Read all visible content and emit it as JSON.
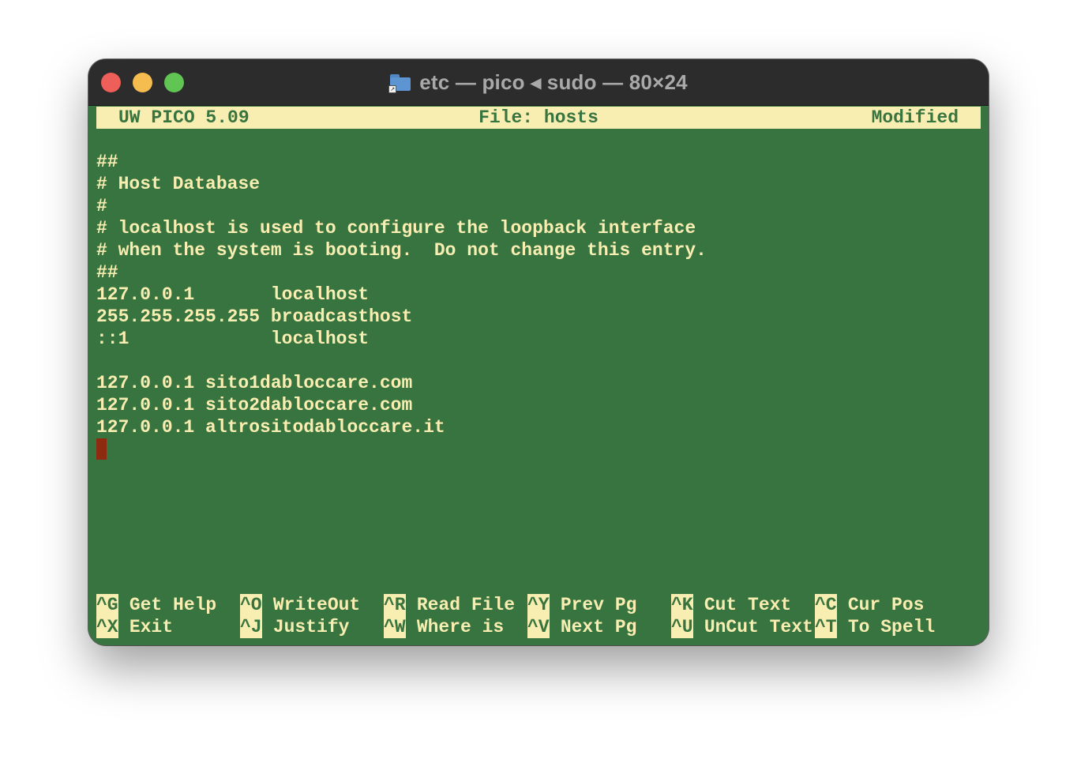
{
  "window": {
    "title": "etc — pico ◂ sudo — 80×24",
    "folder_icon": "folder-icon"
  },
  "header": {
    "app": "UW PICO 5.09",
    "file": "File: hosts",
    "status": "Modified"
  },
  "file_lines": [
    "",
    "##",
    "# Host Database",
    "#",
    "# localhost is used to configure the loopback interface",
    "# when the system is booting.  Do not change this entry.",
    "##",
    "127.0.0.1       localhost",
    "255.255.255.255 broadcasthost",
    "::1             localhost",
    "",
    "127.0.0.1 sito1dabloccare.com",
    "127.0.0.1 sito2dabloccare.com",
    "127.0.0.1 altrositodabloccare.it",
    ""
  ],
  "shortcuts": {
    "row1": [
      {
        "key": "^G",
        "label": "Get Help"
      },
      {
        "key": "^O",
        "label": "WriteOut"
      },
      {
        "key": "^R",
        "label": "Read File"
      },
      {
        "key": "^Y",
        "label": "Prev Pg"
      },
      {
        "key": "^K",
        "label": "Cut Text"
      },
      {
        "key": "^C",
        "label": "Cur Pos"
      }
    ],
    "row2": [
      {
        "key": "^X",
        "label": "Exit"
      },
      {
        "key": "^J",
        "label": "Justify"
      },
      {
        "key": "^W",
        "label": "Where is"
      },
      {
        "key": "^V",
        "label": "Next Pg"
      },
      {
        "key": "^U",
        "label": "UnCut Text"
      },
      {
        "key": "^T",
        "label": "To Spell"
      }
    ]
  },
  "colors": {
    "terminal_bg": "#38743f",
    "terminal_fg": "#f9eeb2",
    "cursor": "#8e2a10",
    "titlebar": "#2c2c2d"
  }
}
